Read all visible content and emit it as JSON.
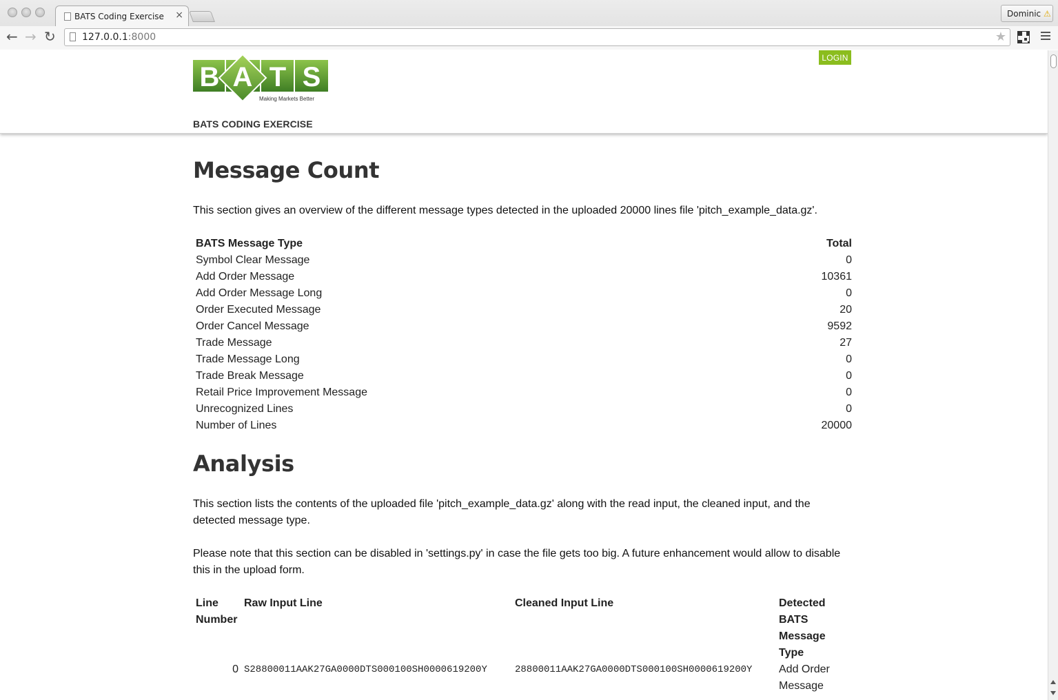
{
  "browser": {
    "tab_title": "BATS Coding Exercise",
    "url_host": "127.0.0.1",
    "url_port": ":8000",
    "profile_name": "Dominic"
  },
  "site": {
    "logo_letters": [
      "B",
      "A",
      "T",
      "S"
    ],
    "logo_tagline": "Making Markets Better",
    "login_label": "LOGIN",
    "title": "BATS CODING EXERCISE",
    "brand_green": "#5a9e32",
    "login_green": "#8bbd1e"
  },
  "message_count": {
    "heading": "Message Count",
    "intro": "This section gives an overview of the different message types detected in the uploaded 20000 lines file 'pitch_example_data.gz'.",
    "col_type": "BATS Message Type",
    "col_total": "Total",
    "rows": [
      {
        "type": "Symbol Clear Message",
        "total": "0"
      },
      {
        "type": "Add Order Message",
        "total": "10361"
      },
      {
        "type": "Add Order Message Long",
        "total": "0"
      },
      {
        "type": "Order Executed Message",
        "total": "20"
      },
      {
        "type": "Order Cancel Message",
        "total": "9592"
      },
      {
        "type": "Trade Message",
        "total": "27"
      },
      {
        "type": "Trade Message Long",
        "total": "0"
      },
      {
        "type": "Trade Break Message",
        "total": "0"
      },
      {
        "type": "Retail Price Improvement Message",
        "total": "0"
      },
      {
        "type": "Unrecognized Lines",
        "total": "0"
      },
      {
        "type": "Number of Lines",
        "total": "20000"
      }
    ]
  },
  "analysis": {
    "heading": "Analysis",
    "para1": "This section lists the contents of the uploaded file 'pitch_example_data.gz' along with the read input, the cleaned input, and the detected message type.",
    "para2": "Please note that this section can be disabled in 'settings.py' in case the file gets too big. A future enhancement would allow to disable this in the upload form.",
    "col_line": "Line Number",
    "col_raw": "Raw Input Line",
    "col_clean": "Cleaned Input Line",
    "col_type": "Detected BATS Message Type",
    "rows": [
      {
        "line": "0",
        "raw": "S28800011AAK27GA0000DTS000100SH0000619200Y",
        "clean": "28800011AAK27GA0000DTS000100SH0000619200Y",
        "type": "Add Order Message"
      }
    ]
  }
}
